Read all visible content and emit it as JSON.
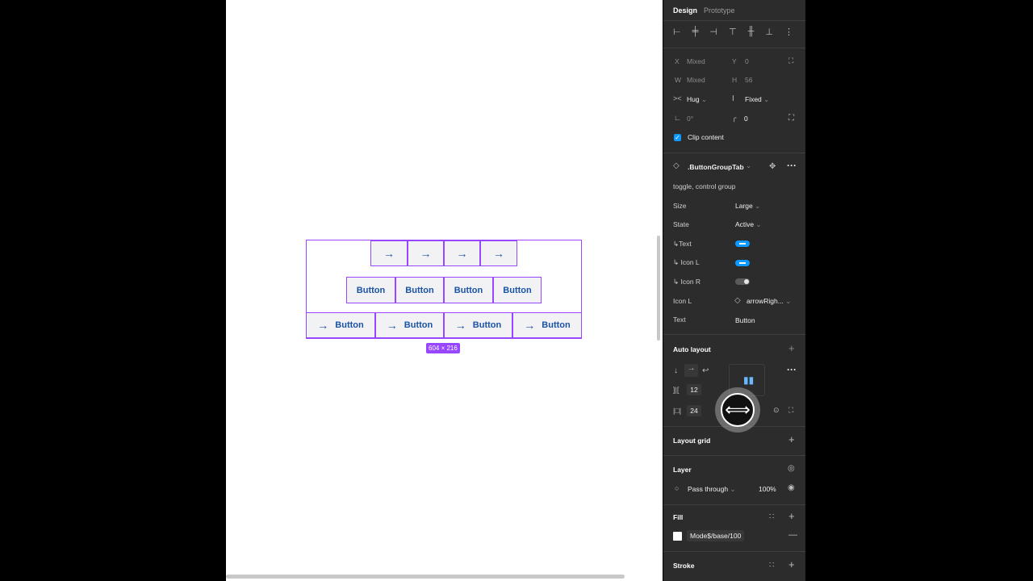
{
  "canvas": {
    "row1": [
      "→",
      "→",
      "→",
      "→"
    ],
    "row2": [
      "Button",
      "Button",
      "Button",
      "Button"
    ],
    "row3": [
      {
        "icon": "→",
        "label": "Button"
      },
      {
        "icon": "→",
        "label": "Button"
      },
      {
        "icon": "→",
        "label": "Button"
      },
      {
        "icon": "→",
        "label": "Button"
      }
    ],
    "dimensions": "604 × 216"
  },
  "panel": {
    "tabs": {
      "design": "Design",
      "prototype": "Prototype"
    },
    "x_label": "X",
    "x_value": "Mixed",
    "y_label": "Y",
    "y_value": "0",
    "w_label": "W",
    "w_value": "Mixed",
    "h_label": "H",
    "h_value": "56",
    "hug_value": "Hug",
    "fixed_value": "Fixed",
    "rotation": "0°",
    "radius": "0",
    "clip_content": "Clip content",
    "component_name": ".ButtonGroupTab",
    "description": "toggle, control group",
    "props": {
      "size_label": "Size",
      "size_value": "Large",
      "state_label": "State",
      "state_value": "Active",
      "text_toggle_label": "↳Text",
      "iconl_toggle_label": "↳ Icon L",
      "iconr_toggle_label": "↳ Icon R",
      "iconl_label": "Icon L",
      "iconl_value": "arrowRigh...",
      "text_label": "Text",
      "text_value": "Button"
    },
    "auto_layout": {
      "title": "Auto layout",
      "gap": "12",
      "padding": "24"
    },
    "layout_grid": "Layout grid",
    "layer": {
      "title": "Layer",
      "blend": "Pass through",
      "opacity": "100%"
    },
    "fill": {
      "title": "Fill",
      "swatch_name": "Mode$/base/100"
    },
    "stroke": {
      "title": "Stroke"
    }
  }
}
